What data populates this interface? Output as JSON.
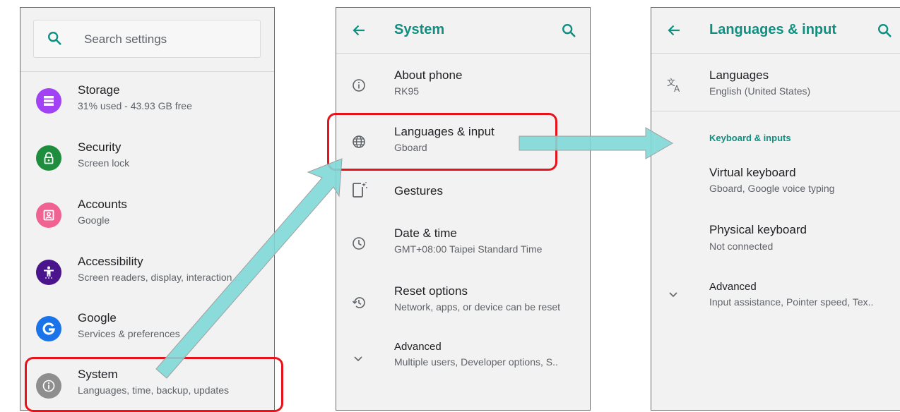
{
  "settings": {
    "search_placeholder": "Search settings",
    "items": [
      {
        "title": "Storage",
        "subtitle": "31% used - 43.93 GB free",
        "color": "#a142f4",
        "icon": "storage-icon"
      },
      {
        "title": "Security",
        "subtitle": "Screen lock",
        "color": "#1e8e3e",
        "icon": "lock-icon"
      },
      {
        "title": "Accounts",
        "subtitle": "Google",
        "color": "#f06292",
        "icon": "account-box-icon"
      },
      {
        "title": "Accessibility",
        "subtitle": "Screen readers, display, interaction ...",
        "color": "#4a148c",
        "icon": "accessibility-icon"
      },
      {
        "title": "Google",
        "subtitle": "Services & preferences",
        "color": "#1a73e8",
        "icon": "google-icon"
      },
      {
        "title": "System",
        "subtitle": "Languages, time, backup, updates",
        "color": "#8e8e8e",
        "icon": "info-icon"
      }
    ]
  },
  "system": {
    "title": "System",
    "items": [
      {
        "title": "About phone",
        "subtitle": "RK95",
        "icon": "info-outline-icon"
      },
      {
        "title": "Languages & input",
        "subtitle": "Gboard",
        "icon": "globe-icon"
      },
      {
        "title": "Gestures",
        "subtitle": "",
        "icon": "gestures-icon"
      },
      {
        "title": "Date & time",
        "subtitle": "GMT+08:00 Taipei Standard Time",
        "icon": "clock-icon"
      },
      {
        "title": "Reset options",
        "subtitle": "Network, apps, or device can be reset",
        "icon": "history-icon"
      },
      {
        "title": "Advanced",
        "subtitle": "Multiple users, Developer options, S..",
        "icon": "chevron-down-icon"
      }
    ]
  },
  "languages": {
    "title": "Languages & input",
    "languages_item": {
      "title": "Languages",
      "subtitle": "English (United States)",
      "icon": "translate-icon"
    },
    "section_header": "Keyboard & inputs",
    "virtual_keyboard": {
      "title": "Virtual keyboard",
      "subtitle": "Gboard, Google voice typing"
    },
    "physical_keyboard": {
      "title": "Physical keyboard",
      "subtitle": "Not connected"
    },
    "advanced": {
      "title": "Advanced",
      "subtitle": "Input assistance, Pointer speed, Tex..",
      "icon": "chevron-down-icon"
    }
  },
  "colors": {
    "accent": "#0f8f7f",
    "highlight": "#e8121a",
    "arrow": "#7fd8d8"
  }
}
